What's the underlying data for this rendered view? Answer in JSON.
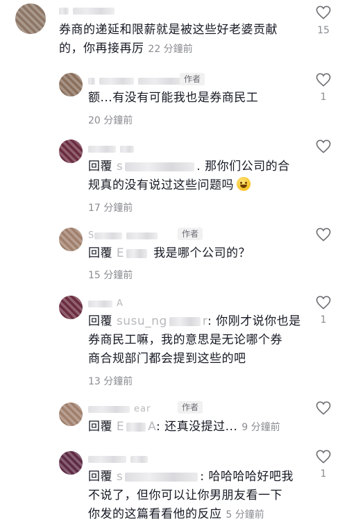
{
  "comments": [
    {
      "author_badge": "",
      "text_line1": "券商的递延和限薪就是被这些好老婆贡献",
      "text_line2": "的，你再接再厉",
      "time": "22 分鐘前",
      "likes": "15",
      "avatar_color": "#8c7565"
    },
    {
      "author_badge": "作者",
      "text_line1": "额...有没有可能我也是券商民工",
      "time": "20 分鐘前",
      "likes": "1",
      "avatar_color": "#8a6f5c"
    },
    {
      "reply_prefix": "回覆",
      "name_suffix": "s",
      "text_line1_rest": ". 那你们公司的合",
      "text_line2": "规真的没有说过这些问题吗",
      "time": "17 分鐘前",
      "likes": "",
      "avatar_color": "#6b2c40"
    },
    {
      "author_badge": "作者",
      "name_prefix": "S",
      "reply_prefix": "回覆",
      "mention_prefix": "E",
      "text_line1_rest": "我是哪个公司的？",
      "time": "15 分鐘前",
      "likes": "",
      "avatar_color": "#a07f6c"
    },
    {
      "name_suffix": "A",
      "reply_prefix": "回覆",
      "mention_prefix": "susu_ng",
      "mention_suffix": "r",
      "text_line1_rest": ": 你刚才说你也是",
      "text_line2": "券商民工嘛，我的意思是无论哪个券",
      "text_line3": "商合规部门都会提到这些的吧",
      "time": "13 分鐘前",
      "likes": "1",
      "avatar_color": "#6b2c40"
    },
    {
      "author_badge": "作者",
      "name_suffix": "ear",
      "reply_prefix": "回覆",
      "mention_prefix": "E",
      "mention_suffix": "A",
      "text_line1_rest": ": 还真没提过...",
      "time": "9 分鐘前",
      "likes": "",
      "avatar_color": "#a07f6c"
    },
    {
      "reply_prefix": "回覆",
      "mention_prefix": "s",
      "text_line1_rest": ": 哈哈哈哈好吧我",
      "text_line2": "不说了，但你可以让你男朋友看一下",
      "text_line3": "你发的这篇看看他的反应",
      "time": "5 分鐘前",
      "likes": "1",
      "avatar_color": "#5e2a44"
    }
  ],
  "icons": {
    "like": "heart-outline-icon",
    "emoji": "rofl-emoji-icon"
  }
}
